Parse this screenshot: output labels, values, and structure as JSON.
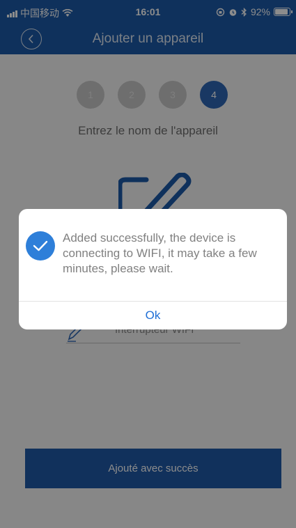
{
  "status_bar": {
    "carrier": "中国移动",
    "time": "16:01",
    "battery": "92%",
    "battery_level": 0.92
  },
  "nav": {
    "title": "Ajouter un appareil",
    "back_icon": "chevron-left-icon"
  },
  "steps": {
    "items": [
      "1",
      "2",
      "3",
      "4"
    ],
    "active_index": 3,
    "description": "Entrez le nom de l'appareil"
  },
  "device_name": {
    "value": "Interrupteur WIFI"
  },
  "primary_button": {
    "label": "Ajouté avec succès"
  },
  "dialog": {
    "message": "Added successfully, the device is connecting to WIFI, it may take a few minutes, please wait.",
    "ok_label": "Ok"
  },
  "colors": {
    "brand": "#1d5aa8",
    "accent": "#2e7fd9",
    "link": "#1f6fd6"
  }
}
